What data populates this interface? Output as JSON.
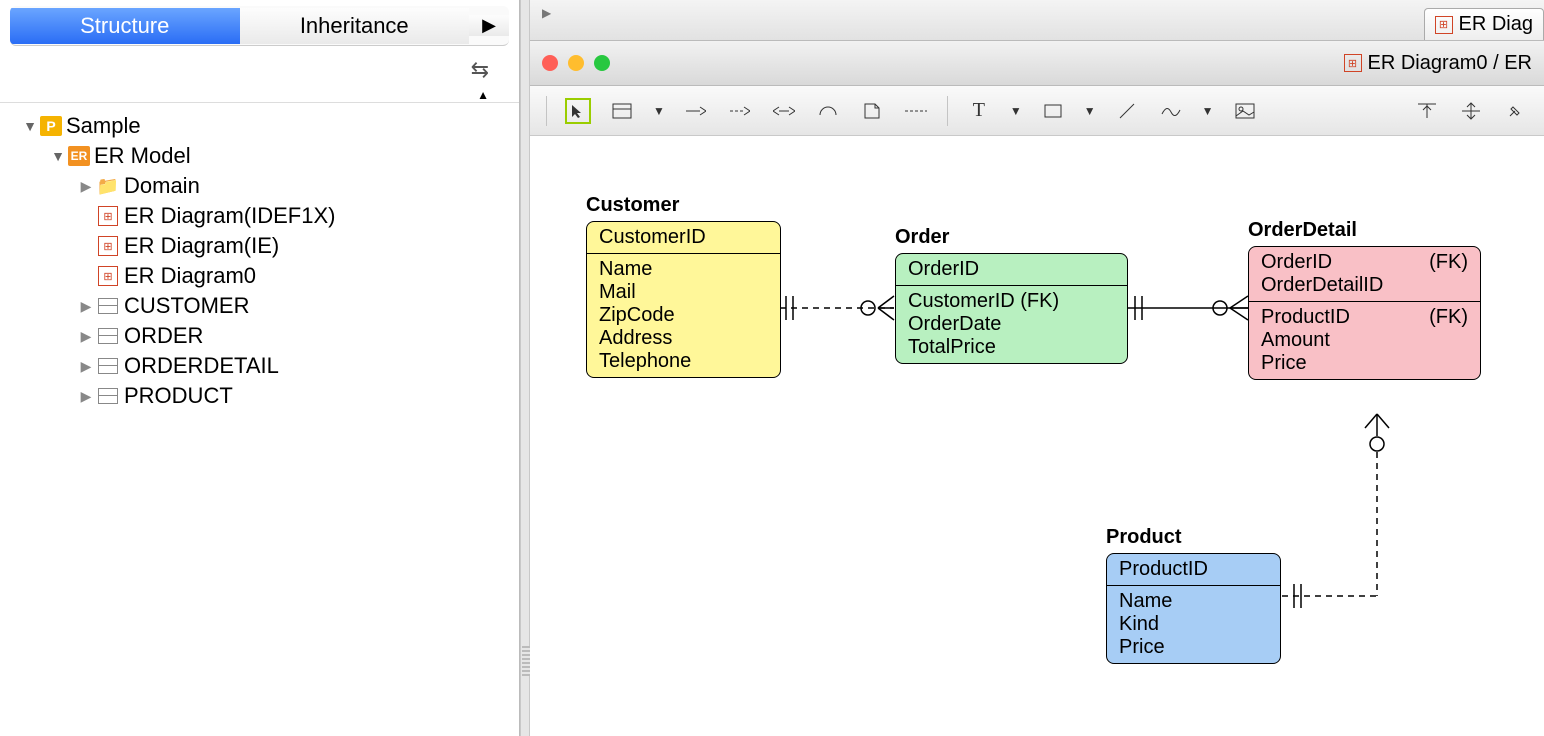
{
  "tabs": {
    "structure": "Structure",
    "inheritance": "Inheritance"
  },
  "tree": {
    "root": "Sample",
    "model": "ER Model",
    "domain": "Domain",
    "dg1": "ER Diagram(IDEF1X)",
    "dg2": "ER Diagram(IE)",
    "dg3": "ER Diagram0",
    "t1": "CUSTOMER",
    "t2": "ORDER",
    "t3": "ORDERDETAIL",
    "t4": "PRODUCT"
  },
  "topTab": "ER Diag",
  "windowTitle": "ER Diagram0 / ER",
  "entities": {
    "customer": {
      "title": "Customer",
      "pk": "CustomerID",
      "attrs": [
        "Name",
        "Mail",
        "ZipCode",
        "Address",
        "Telephone"
      ]
    },
    "order": {
      "title": "Order",
      "pk": "OrderID",
      "fk": "CustomerID (FK)",
      "attrs": [
        "OrderDate",
        "TotalPrice"
      ]
    },
    "orderDetail": {
      "title": "OrderDetail",
      "pk1": "OrderID",
      "pk1fk": "(FK)",
      "pk2": "OrderDetailID",
      "a1": "ProductID",
      "a1fk": "(FK)",
      "attrs": [
        "Amount",
        "Price"
      ]
    },
    "product": {
      "title": "Product",
      "pk": "ProductID",
      "attrs": [
        "Name",
        "Kind",
        "Price"
      ]
    }
  }
}
